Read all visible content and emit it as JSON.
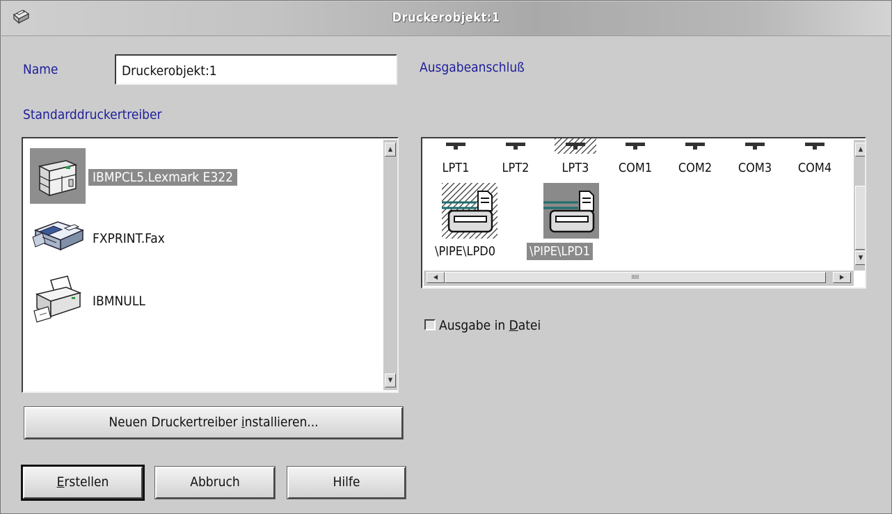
{
  "window": {
    "title": "Druckerobjekt:1"
  },
  "name_field": {
    "label": "Name",
    "value": "Druckerobjekt:1"
  },
  "drivers": {
    "label": "Standarddruckertreiber",
    "items": [
      {
        "name": "IBMPCL5.Lexmark E322",
        "icon": "laser-printer-icon",
        "selected": true
      },
      {
        "name": "FXPRINT.Fax",
        "icon": "fax-icon",
        "selected": false
      },
      {
        "name": "IBMNULL",
        "icon": "printer-icon",
        "selected": false
      }
    ]
  },
  "ports": {
    "label": "Ausgabeanschluß",
    "row1": [
      "LPT1",
      "LPT2",
      "LPT3",
      "COM1",
      "COM2",
      "COM3",
      "COM4"
    ],
    "row2": [
      {
        "name": "\\PIPE\\LPD0",
        "selected": false
      },
      {
        "name": "\\PIPE\\LPD1",
        "selected": true
      }
    ]
  },
  "output_to_file": {
    "label": "Ausgabe in Datei",
    "checked": false
  },
  "buttons": {
    "install": "Neuen Druckertreiber installieren...",
    "create": "Erstellen",
    "cancel": "Abbruch",
    "help": "Hilfe"
  }
}
